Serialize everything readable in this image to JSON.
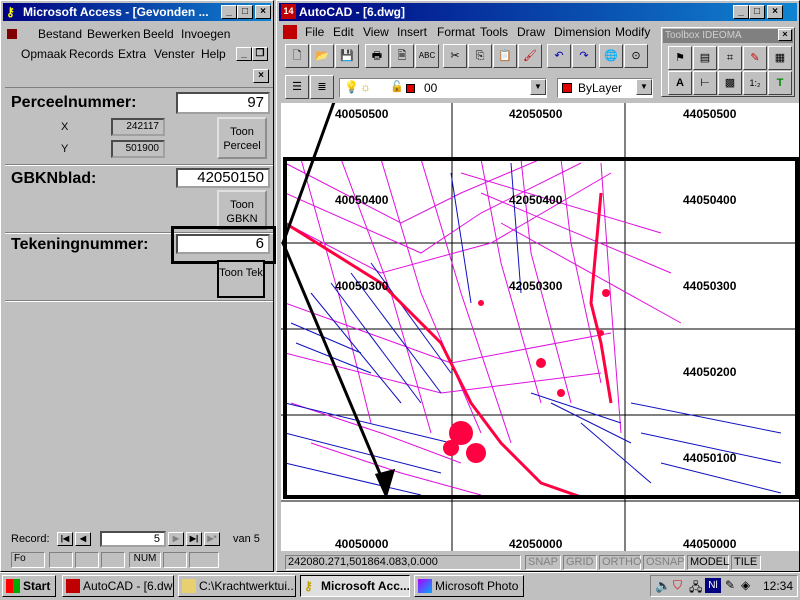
{
  "access": {
    "title": "Microsoft Access - [Gevonden ...",
    "menu": [
      "Bestand",
      "Bewerken",
      "Beeld",
      "Invoegen",
      "Opmaak",
      "Records",
      "Extra",
      "Venster",
      "Help"
    ],
    "perceel_label": "Perceelnummer:",
    "perceel_value": "97",
    "x_label": "X",
    "x_value": "242117",
    "y_label": "Y",
    "y_value": "501900",
    "toon_perceel": "Toon Perceel",
    "gbkn_label": "GBKNblad:",
    "gbkn_value": "42050150",
    "toon_gbkn": "Toon GBKN",
    "tekening_label": "Tekeningnummer:",
    "tekening_value": "6",
    "toon_tek": "Toon Tek",
    "record_label": "Record:",
    "record_value": "5",
    "record_total": "van 5",
    "status_fo": "Fo",
    "status_num": "NUM"
  },
  "autocad": {
    "title": "AutoCAD - [6.dwg]",
    "menu": [
      "File",
      "Edit",
      "View",
      "Insert",
      "Format",
      "Tools",
      "Draw",
      "Dimension",
      "Modify"
    ],
    "layer_value": "00",
    "color_value": "ByLayer",
    "toolbox_title": "Toolbox IDEOMA",
    "grid_labels": {
      "top": [
        "40050500",
        "42050500",
        "44050500"
      ],
      "row400": [
        "40050400",
        "42050400",
        "44050400"
      ],
      "row300": [
        "40050300",
        "42050300",
        "44050300"
      ],
      "right200": "44050200",
      "right100": "44050100",
      "bottom": [
        "40050000",
        "42050000",
        "44050000"
      ]
    },
    "coords": "242080.271,501864.083,0.000",
    "status_toggles": [
      "SNAP",
      "GRID",
      "ORTHO",
      "OSNAP",
      "MODEL",
      "TILE"
    ]
  },
  "taskbar": {
    "start": "Start",
    "buttons": [
      "AutoCAD - [6.dwg]",
      "C:\\Krachtwerktui...",
      "Microsoft Acc...",
      "Microsoft Photo ..."
    ],
    "clock": "12:34",
    "tray_lang": "Nl"
  },
  "colors": {
    "title_active": "#000080",
    "map_magenta": "#e010e0",
    "map_blue": "#1010c0",
    "map_red": "#ff0040"
  }
}
